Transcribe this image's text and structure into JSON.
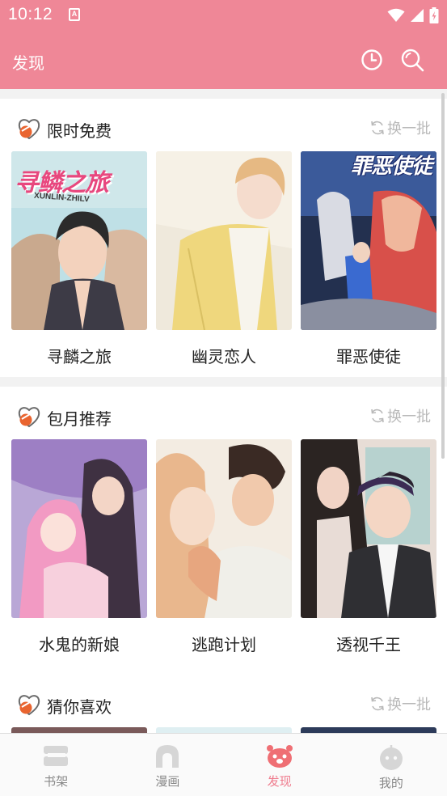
{
  "status_bar": {
    "time": "10:12",
    "notification_glyph": "A"
  },
  "app_bar": {
    "title": "发现",
    "history_icon": "clock-icon",
    "search_icon": "search-icon"
  },
  "sections": [
    {
      "title": "限时免费",
      "refresh_label": "换一批",
      "items": [
        {
          "title": "寻麟之旅",
          "cover_text": "寻鳞之旅",
          "cover_subtext": "XUNLIN-ZHILV"
        },
        {
          "title": "幽灵恋人"
        },
        {
          "title": "罪恶使徒",
          "cover_text": "罪恶使徒"
        }
      ]
    },
    {
      "title": "包月推荐",
      "refresh_label": "换一批",
      "items": [
        {
          "title": "水鬼的新娘"
        },
        {
          "title": "逃跑计划"
        },
        {
          "title": "透视千王"
        }
      ]
    },
    {
      "title": "猜你喜欢",
      "refresh_label": "换一批",
      "items": []
    }
  ],
  "tabs": [
    {
      "label": "书架",
      "icon": "bookshelf-icon",
      "active": false
    },
    {
      "label": "漫画",
      "icon": "comic-icon",
      "active": false
    },
    {
      "label": "发现",
      "icon": "discover-icon",
      "active": true
    },
    {
      "label": "我的",
      "icon": "profile-icon",
      "active": false
    }
  ],
  "colors": {
    "brand": "#ef8797",
    "active_tab": "#ef7b8d",
    "inactive": "#d6d6d6",
    "section_icon": "#e9642f"
  }
}
